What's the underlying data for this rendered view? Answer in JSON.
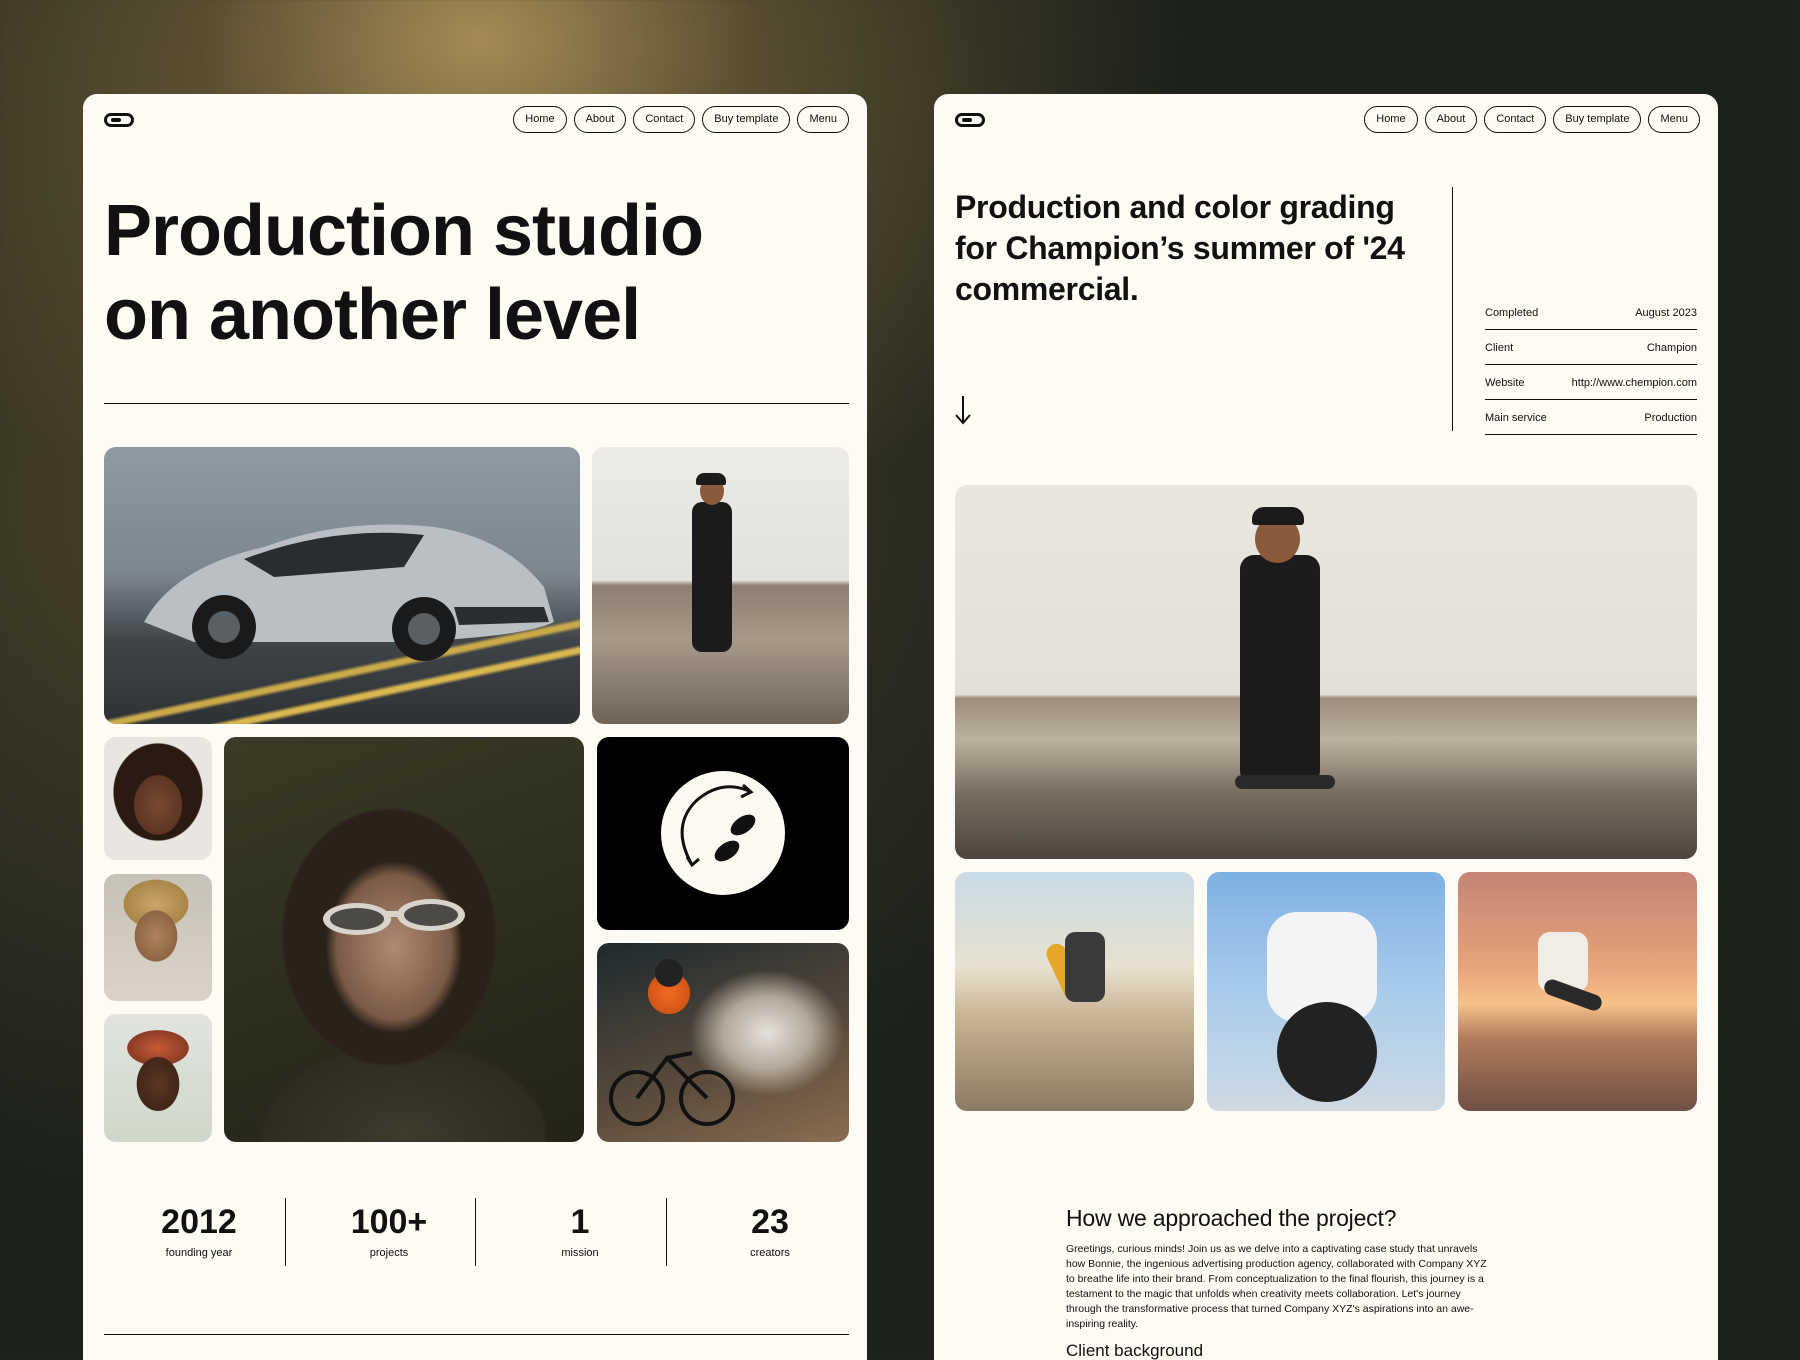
{
  "nav": {
    "links": [
      "Home",
      "About",
      "Contact",
      "Buy template",
      "Menu"
    ]
  },
  "home": {
    "hero_title_line1": "Production studio",
    "hero_title_line2": "on another level",
    "stats": [
      {
        "value": "2012",
        "label": "founding year"
      },
      {
        "value": "100+",
        "label": "projects"
      },
      {
        "value": "1",
        "label": "mission"
      },
      {
        "value": "23",
        "label": "creators"
      }
    ]
  },
  "project": {
    "title": "Production and color grading for Champion’s summer of '24 commercial.",
    "meta": [
      {
        "label": "Completed",
        "value": "August 2023"
      },
      {
        "label": "Client",
        "value": "Champion"
      },
      {
        "label": "Website",
        "value": "http://www.chempion.com"
      },
      {
        "label": "Main service",
        "value": "Production"
      }
    ],
    "section_heading": "How we approached the project?",
    "section_body": "Greetings, curious minds! Join us as we delve into a captivating case study that unravels how Bonnie, the ingenious advertising production agency, collaborated with Company XYZ to breathe life into their brand. From conceptualization to the final flourish, this journey is a testament to the magic that unfolds when creativity meets collaboration. Let's journey through the transformative process that turned Company XYZ's aspirations into an awe-inspiring reality.",
    "section_subheading": "Client background"
  },
  "colors": {
    "page_bg": "#fdfbf4",
    "ink": "#111111",
    "backdrop": "#1c211b"
  }
}
